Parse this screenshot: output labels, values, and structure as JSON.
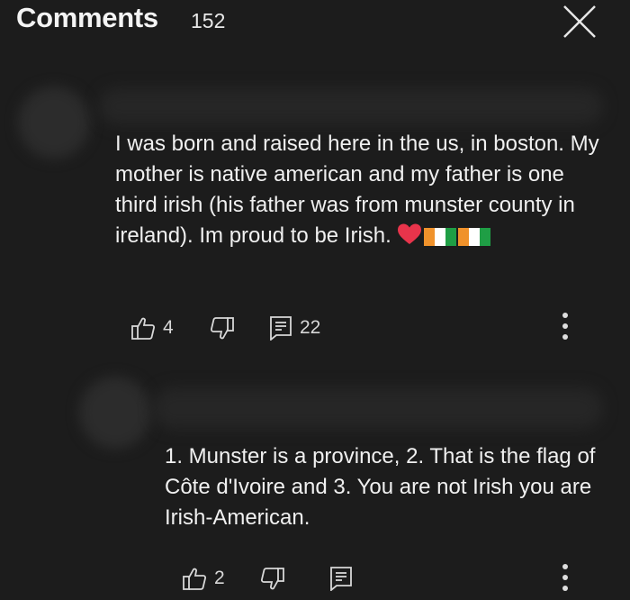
{
  "header": {
    "title": "Comments",
    "count": "152"
  },
  "comments": [
    {
      "text": "I was born and raised here in the us, in boston. My mother is native american and my father is one third irish (his father was from munster county in ireland). Im proud to be Irish.",
      "emoji": [
        "red-heart",
        "flag-cote-divoire",
        "flag-cote-divoire"
      ],
      "likes": "4",
      "replies": "22"
    },
    {
      "text": "1. Munster is a province, 2. That is the flag of Côte d'Ivoire and 3. You are not Irish you are Irish-American.",
      "likes": "2",
      "replies": ""
    }
  ],
  "icons": {
    "close": "close-icon",
    "like": "thumbs-up-icon",
    "dislike": "thumbs-down-icon",
    "reply": "reply-icon",
    "more": "more-vertical-icon"
  },
  "colors": {
    "background": "#1c1c1c",
    "text": "#f1f1f1",
    "heart": "#e8344b",
    "flag_orange": "#f0922b",
    "flag_white": "#ffffff",
    "flag_green": "#1f9e45"
  }
}
